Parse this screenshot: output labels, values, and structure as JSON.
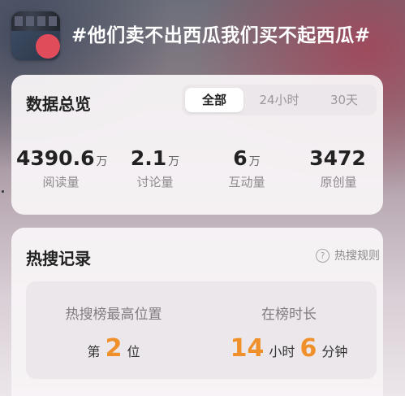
{
  "header": {
    "topic_title": "#他们卖不出西瓜我们买不起西瓜#",
    "thumbnail_icon": "topic-thumbnail"
  },
  "overview": {
    "title": "数据总览",
    "tabs": [
      {
        "label": "全部",
        "active": true
      },
      {
        "label": "24小时",
        "active": false
      },
      {
        "label": "30天",
        "active": false
      }
    ],
    "stats": [
      {
        "value": "4390.6",
        "unit": "万",
        "label": "阅读量"
      },
      {
        "value": "2.1",
        "unit": "万",
        "label": "讨论量"
      },
      {
        "value": "6",
        "unit": "万",
        "label": "互动量"
      },
      {
        "value": "3472",
        "unit": "",
        "label": "原创量"
      }
    ]
  },
  "hot_search": {
    "title": "热搜记录",
    "rules_label": "热搜规则",
    "rules_icon": "question-circle-icon",
    "peak": {
      "label": "热搜榜最高位置",
      "prefix": "第",
      "value": "2",
      "suffix": "位"
    },
    "duration": {
      "label": "在榜时长",
      "hours": "14",
      "hours_unit": "小时",
      "minutes": "6",
      "minutes_unit": "分钟"
    }
  },
  "colors": {
    "accent_orange": "#f0902a",
    "title_text": "#ffffff"
  }
}
